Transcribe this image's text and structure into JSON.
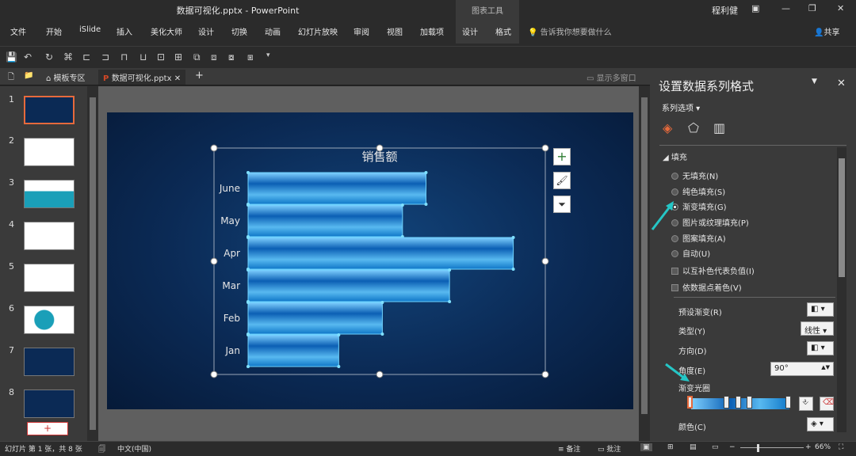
{
  "window": {
    "title": "数据可视化.pptx  -  PowerPoint",
    "context_tab": "图表工具",
    "user": "程利健"
  },
  "ribbon_tabs": [
    "文件",
    "开始",
    "iSlide",
    "插入",
    "美化大师",
    "设计",
    "切换",
    "动画",
    "幻灯片放映",
    "审阅",
    "视图",
    "加载项",
    "设计",
    "格式"
  ],
  "tell_me": "告诉我你想要做什么",
  "share": "共享",
  "doc_tabs": {
    "template": "模板专区",
    "file": "数据可视化.pptx",
    "show_multi": "显示多窗口"
  },
  "thumbnails": [
    "1",
    "2",
    "3",
    "4",
    "5",
    "6",
    "7",
    "8"
  ],
  "add_slide": "+",
  "chart_data": {
    "type": "bar",
    "orientation": "horizontal",
    "title": "销售额",
    "categories": [
      "June",
      "May",
      "Apr",
      "Mar",
      "Feb",
      "Jan"
    ],
    "values": [
      5.3,
      4.6,
      7.9,
      6.0,
      4.0,
      2.7
    ],
    "xlim": [
      0,
      8.5
    ],
    "grid": false,
    "legend": "none"
  },
  "panel": {
    "title": "设置数据系列格式",
    "series_options": "系列选项",
    "fill_section": "填充",
    "fill_options": [
      {
        "label": "无填充(N)",
        "selected": false
      },
      {
        "label": "纯色填充(S)",
        "selected": false
      },
      {
        "label": "渐变填充(G)",
        "selected": true
      },
      {
        "label": "图片或纹理填充(P)",
        "selected": false
      },
      {
        "label": "图案填充(A)",
        "selected": false
      },
      {
        "label": "自动(U)",
        "selected": false
      }
    ],
    "checks": [
      "以互补色代表负值(I)",
      "依数据点着色(V)"
    ],
    "preset_label": "预设渐变(R)",
    "type_label": "类型(Y)",
    "type_value": "线性",
    "direction_label": "方向(D)",
    "angle_label": "角度(E)",
    "angle_value": "90°",
    "stops_label": "渐变光圈",
    "color_label": "颜色(C)"
  },
  "status": {
    "slide_info": "幻灯片 第 1 张，共 8 张",
    "lang": "中文(中国)",
    "notes": "备注",
    "comments": "批注",
    "zoom": "66%"
  }
}
